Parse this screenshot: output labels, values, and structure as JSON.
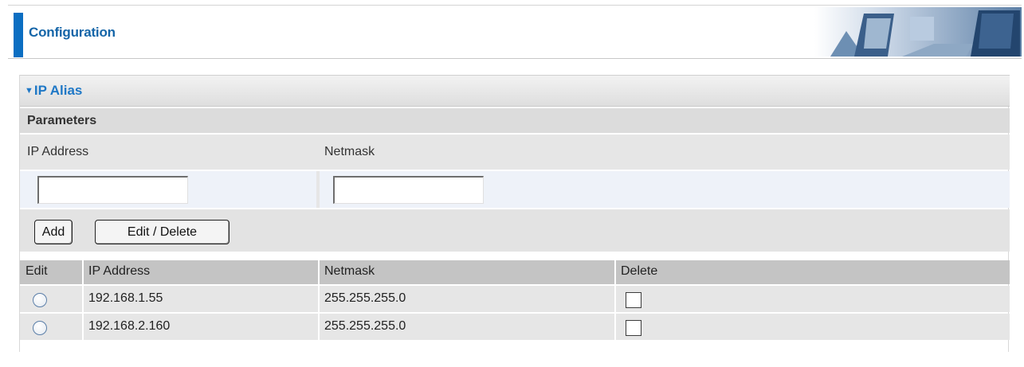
{
  "header": {
    "title": "Configuration"
  },
  "section": {
    "title": "IP Alias"
  },
  "parameters": {
    "label": "Parameters",
    "ip_label": "IP Address",
    "netmask_label": "Netmask",
    "ip_value": "",
    "netmask_value": ""
  },
  "buttons": {
    "add": "Add",
    "edit_delete": "Edit / Delete"
  },
  "table": {
    "headers": [
      "Edit",
      "IP Address",
      "Netmask",
      "Delete"
    ],
    "rows": [
      {
        "ip": "192.168.1.55",
        "netmask": "255.255.255.0",
        "edit_selected": false,
        "delete_checked": false
      },
      {
        "ip": "192.168.2.160",
        "netmask": "255.255.255.0",
        "edit_selected": false,
        "delete_checked": false
      }
    ]
  },
  "colors": {
    "accent": "#0b6ec2",
    "title": "#1565a8",
    "section_title": "#1f78c6"
  }
}
